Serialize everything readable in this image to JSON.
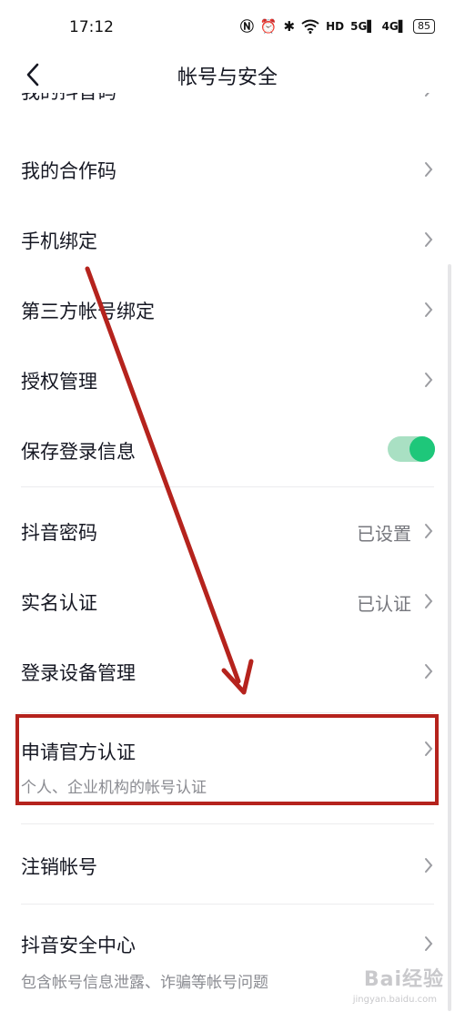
{
  "status_bar": {
    "time": "17:12",
    "icons": [
      "nfc-icon",
      "alarm-icon",
      "bluetooth-icon",
      "wifi-icon",
      "hd-icon",
      "signal-5g-icon",
      "signal-4g-icon"
    ],
    "network_5g": "5G",
    "network_4g": "4G",
    "hd_label": "HD",
    "battery": "85"
  },
  "nav": {
    "title": "帐号与安全"
  },
  "settings": {
    "items": [
      {
        "label": "我的抖音码"
      },
      {
        "label": "我的合作码"
      },
      {
        "label": "手机绑定"
      },
      {
        "label": "第三方帐号绑定"
      },
      {
        "label": "授权管理"
      },
      {
        "label": "保存登录信息",
        "toggle_on": true
      },
      {
        "label": "抖音密码",
        "value": "已设置"
      },
      {
        "label": "实名认证",
        "value": "已认证"
      },
      {
        "label": "登录设备管理"
      },
      {
        "label": "申请官方认证",
        "subtitle": "个人、企业机构的帐号认证"
      },
      {
        "label": "注销帐号"
      },
      {
        "label": "抖音安全中心",
        "subtitle": "包含帐号信息泄露、诈骗等帐号问题"
      }
    ]
  },
  "colors": {
    "annotation": "#b5231d",
    "toggle_on": "#1ec77a",
    "text_primary": "#161823",
    "text_secondary": "#8a8b91"
  },
  "watermark": {
    "text": "Bai经验",
    "sub": "jingyan.baidu.com"
  }
}
